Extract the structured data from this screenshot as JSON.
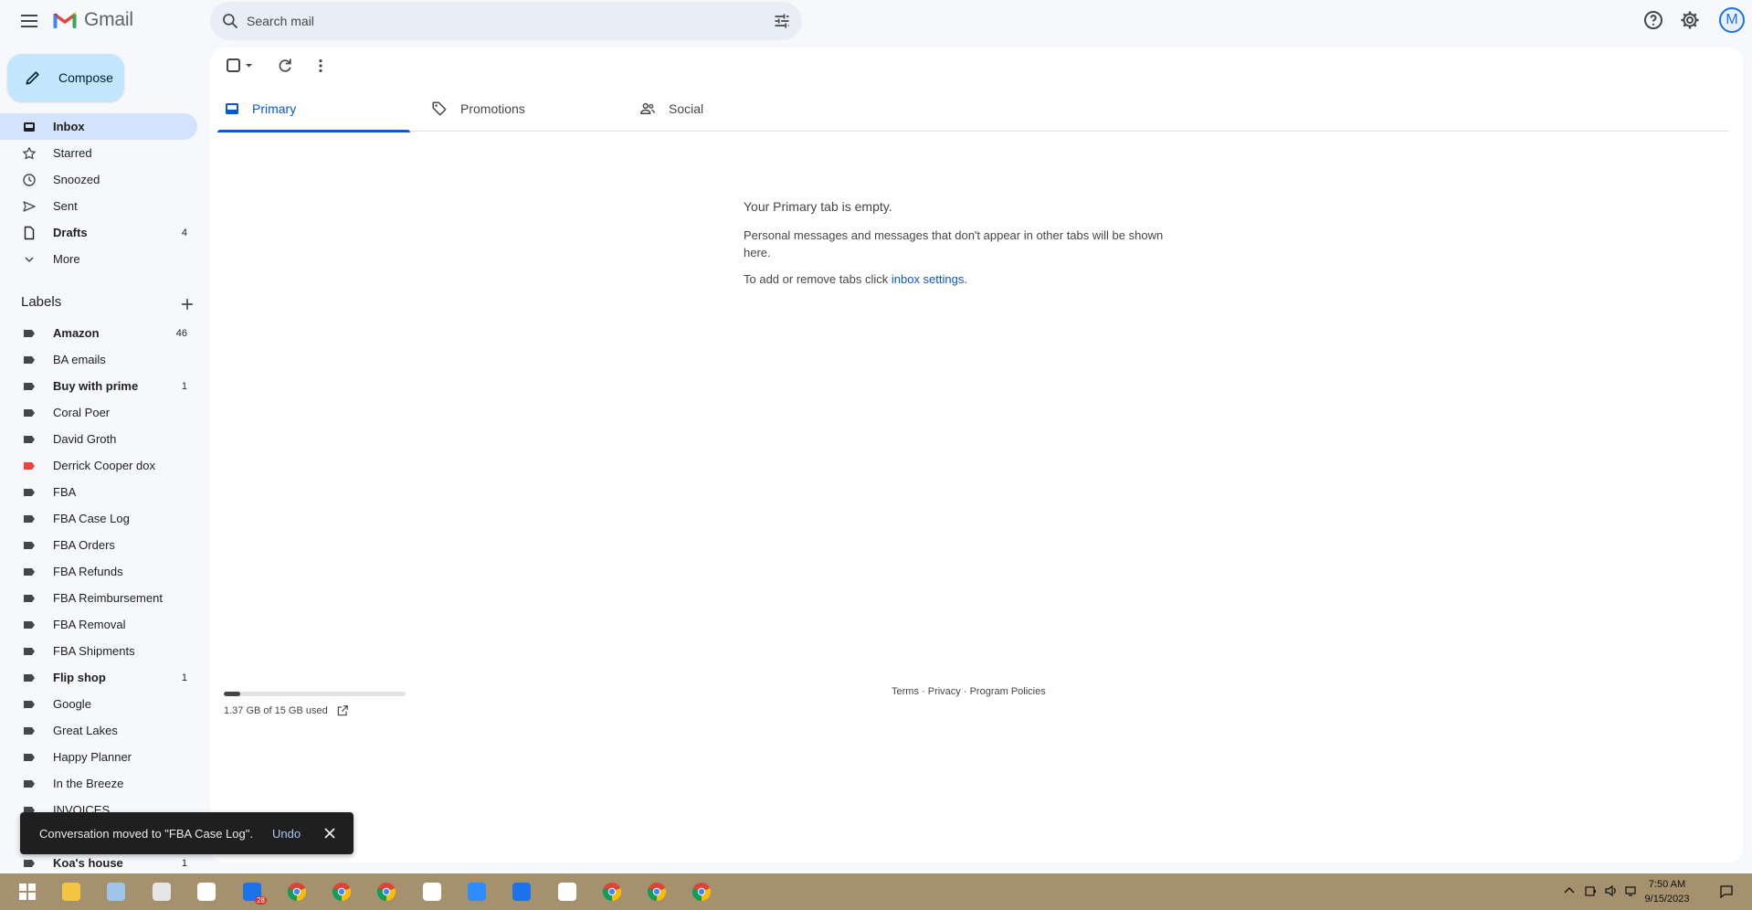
{
  "header": {
    "app_name": "Gmail",
    "search_placeholder": "Search mail",
    "avatar_letter": "M",
    "icons": [
      "menu-icon",
      "search-icon",
      "tune-icon",
      "help-icon",
      "settings-icon"
    ]
  },
  "sidebar": {
    "compose_label": "Compose",
    "nav": [
      {
        "label": "Inbox",
        "count": "",
        "icon": "inbox-icon",
        "active": true,
        "bold": true
      },
      {
        "label": "Starred",
        "count": "",
        "icon": "star-icon"
      },
      {
        "label": "Snoozed",
        "count": "",
        "icon": "clock-icon"
      },
      {
        "label": "Sent",
        "count": "",
        "icon": "send-icon"
      },
      {
        "label": "Drafts",
        "count": "4",
        "icon": "draft-icon",
        "bold": true
      },
      {
        "label": "More",
        "count": "",
        "icon": "chevron-down-icon"
      }
    ],
    "labels_title": "Labels",
    "labels": [
      {
        "label": "Amazon",
        "count": "46",
        "bold": true,
        "color": "#444746"
      },
      {
        "label": "BA emails",
        "count": "",
        "bold": false,
        "color": "#444746"
      },
      {
        "label": "Buy with prime",
        "count": "1",
        "bold": true,
        "color": "#444746"
      },
      {
        "label": "Coral Poer",
        "count": "",
        "bold": false,
        "color": "#444746"
      },
      {
        "label": "David Groth",
        "count": "",
        "bold": false,
        "color": "#444746"
      },
      {
        "label": "Derrick Cooper dox",
        "count": "",
        "bold": false,
        "color": "#e8453c"
      },
      {
        "label": "FBA",
        "count": "",
        "bold": false,
        "color": "#444746"
      },
      {
        "label": "FBA Case Log",
        "count": "",
        "bold": false,
        "color": "#444746"
      },
      {
        "label": "FBA Orders",
        "count": "",
        "bold": false,
        "color": "#444746"
      },
      {
        "label": "FBA Refunds",
        "count": "",
        "bold": false,
        "color": "#444746"
      },
      {
        "label": "FBA Reimbursement",
        "count": "",
        "bold": false,
        "color": "#444746"
      },
      {
        "label": "FBA Removal",
        "count": "",
        "bold": false,
        "color": "#444746"
      },
      {
        "label": "FBA Shipments",
        "count": "",
        "bold": false,
        "color": "#444746"
      },
      {
        "label": "Flip shop",
        "count": "1",
        "bold": true,
        "color": "#444746"
      },
      {
        "label": "Google",
        "count": "",
        "bold": false,
        "color": "#444746"
      },
      {
        "label": "Great Lakes",
        "count": "",
        "bold": false,
        "color": "#444746"
      },
      {
        "label": "Happy Planner",
        "count": "",
        "bold": false,
        "color": "#444746"
      },
      {
        "label": "In the Breeze",
        "count": "",
        "bold": false,
        "color": "#444746"
      },
      {
        "label": "INVOICES",
        "count": "",
        "bold": false,
        "color": "#444746"
      },
      {
        "label": "",
        "count": "",
        "bold": false,
        "color": "#444746"
      },
      {
        "label": "Koa's house",
        "count": "1",
        "bold": true,
        "color": "#444746"
      }
    ]
  },
  "main": {
    "tabs": [
      {
        "label": "Primary",
        "icon": "inbox-tab-icon",
        "active": true
      },
      {
        "label": "Promotions",
        "icon": "tag-icon",
        "active": false
      },
      {
        "label": "Social",
        "icon": "people-icon",
        "active": false
      }
    ],
    "empty": {
      "title": "Your Primary tab is empty.",
      "text": "Personal messages and messages that don't appear in other tabs will be shown here.",
      "link_prefix": "To add or remove tabs click ",
      "link_text": "inbox settings",
      "link_suffix": "."
    },
    "storage": {
      "text": "1.37 GB of 15 GB used",
      "used_fraction": 0.091
    },
    "footer_links": [
      "Terms",
      "Privacy",
      "Program Policies"
    ],
    "footer_separator": " · "
  },
  "snackbar": {
    "message": "Conversation moved to \"FBA Case Log\".",
    "action": "Undo"
  },
  "taskbar": {
    "apps": [
      {
        "name": "windows-start-icon",
        "color": "#ffffff"
      },
      {
        "name": "file-explorer-icon",
        "color": "#f4c542"
      },
      {
        "name": "notepad-icon",
        "color": "#9fc5e8"
      },
      {
        "name": "calculator-icon",
        "color": "#e6e6e6"
      },
      {
        "name": "slack-icon",
        "color": "#ffffff"
      },
      {
        "name": "mail-app-icon",
        "color": "#1a73e8",
        "badge": "28"
      },
      {
        "name": "chrome-icon",
        "color": "#4285f4"
      },
      {
        "name": "chrome-profile-icon",
        "color": "#4285f4"
      },
      {
        "name": "chrome-profile-k-icon",
        "color": "#4285f4"
      },
      {
        "name": "app-icon",
        "color": "#ffffff"
      },
      {
        "name": "zoom-icon",
        "color": "#2d8cff"
      },
      {
        "name": "r-app-icon",
        "color": "#1a73e8"
      },
      {
        "name": "app-icon-2",
        "color": "#ffffff"
      },
      {
        "name": "chrome-profile-d-icon",
        "color": "#4285f4"
      },
      {
        "name": "chrome-profile-k2-icon",
        "color": "#4285f4"
      },
      {
        "name": "chrome-icon-2",
        "color": "#4285f4"
      }
    ],
    "time": "7:50 AM",
    "date": "9/15/2023"
  }
}
